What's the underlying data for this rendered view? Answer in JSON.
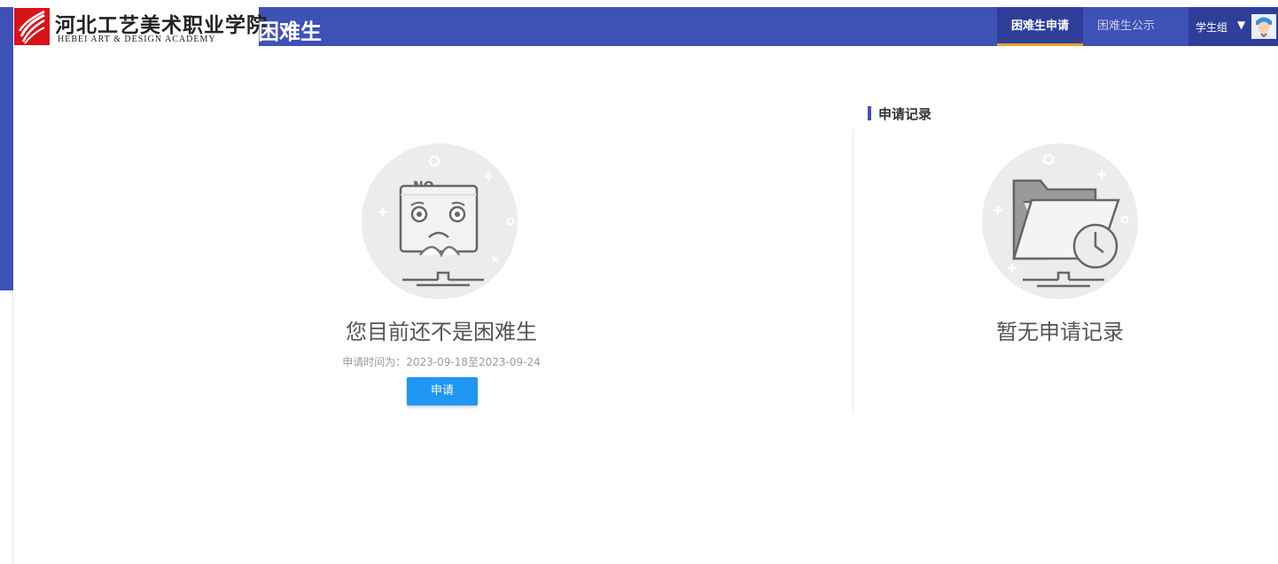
{
  "header": {
    "logo_cn": "河北工艺美术职业学院",
    "logo_en": "HEBEI ART & DESIGN ACADEMY",
    "module_title": "困难生",
    "brand_color": "#3e51b5",
    "nav": [
      {
        "label": "困难生申请",
        "active": true
      },
      {
        "label": "困难生公示",
        "active": false
      }
    ],
    "user": {
      "name": "学生组",
      "caret": "▼"
    }
  },
  "status": {
    "title": "您目前还不是困难生",
    "apply_time": "申请时间为：2023-09-18至2023-09-24",
    "apply_button": "申请",
    "badge_text": "NO",
    "button_color": "#2196f3"
  },
  "records": {
    "heading": "申请记录",
    "empty_text": "暂无申请记录"
  }
}
